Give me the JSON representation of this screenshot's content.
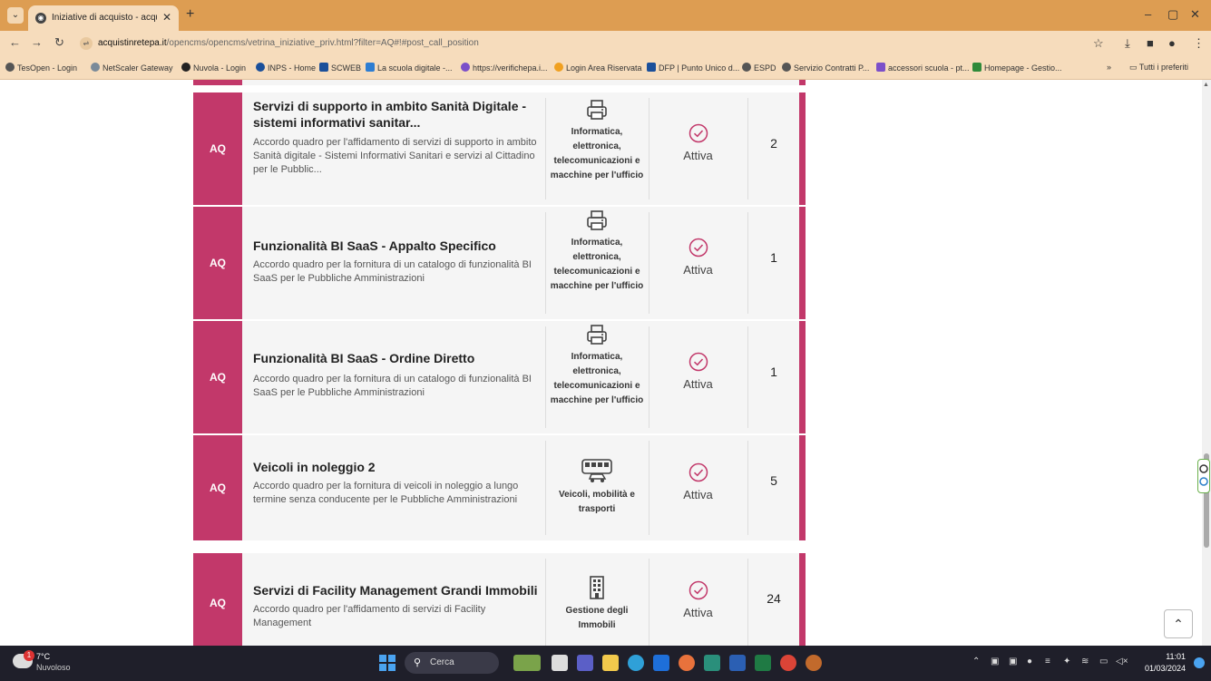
{
  "browser": {
    "tab_title": "Iniziative di acquisto - acquistinretepa",
    "url_domain": "acquistinretepa.it",
    "url_path": "/opencms/opencms/vetrina_iniziative_priv.html?filter=AQ#!#post_call_position",
    "bookmarks": [
      "TesOpen - Login",
      "NetScaler Gateway",
      "Nuvola - Login",
      "INPS - Home",
      "SCWEB",
      "La scuola digitale -...",
      "https://verifichepa.i...",
      "Login Area Riservata",
      "DFP | Punto Unico d...",
      "ESPD",
      "Servizio Contratti P...",
      "accessori scuola - pt...",
      "Homepage - Gestio..."
    ],
    "all_bookmarks_label": "Tutti i preferiti"
  },
  "colors": {
    "accent": "#c2386a",
    "tabbar": "#dd9d52",
    "toolbar": "#f6dcbc",
    "row_bg": "#f5f5f5"
  },
  "rows": [
    {
      "badge": "AQ",
      "title": "Servizi di supporto in ambito Sanità Digitale - sistemi informativi sanitar...",
      "description": "Accordo quadro per l'affidamento di servizi di supporto in ambito Sanità digitale - Sistemi Informativi Sanitari e servizi al Cittadino per le Pubblic...",
      "category": "Informatica, elettronica, telecomunicazioni e macchine per l'ufficio",
      "category_icon": "printer-icon",
      "status": "Attiva",
      "count": "2"
    },
    {
      "badge": "AQ",
      "title": "Funzionalità BI SaaS - Appalto Specifico",
      "description": "Accordo quadro per la fornitura di un catalogo di funzionalità BI SaaS per le Pubbliche Amministrazioni",
      "category": "Informatica, elettronica, telecomunicazioni e macchine per l'ufficio",
      "category_icon": "printer-icon",
      "status": "Attiva",
      "count": "1"
    },
    {
      "badge": "AQ",
      "title": "Funzionalità BI SaaS - Ordine Diretto",
      "description": "Accordo quadro per la fornitura di un catalogo di funzionalità BI SaaS per le Pubbliche Amministrazioni",
      "category": "Informatica, elettronica, telecomunicazioni e macchine per l'ufficio",
      "category_icon": "printer-icon",
      "status": "Attiva",
      "count": "1"
    },
    {
      "badge": "AQ",
      "title": "Veicoli in noleggio 2",
      "description": "Accordo quadro per la fornitura di veicoli in noleggio a lungo termine senza conducente per le Pubbliche Amministrazioni",
      "category": "Veicoli, mobilità e trasporti",
      "category_icon": "vehicles-icon",
      "status": "Attiva",
      "count": "5"
    },
    {
      "badge": "AQ",
      "title": "Servizi di Facility Management Grandi Immobili",
      "description": "Accordo quadro per l'affidamento di servizi di Facility Management",
      "category": "Gestione degli Immobili",
      "category_icon": "building-icon",
      "status": "Attiva",
      "count": "24"
    }
  ],
  "taskbar": {
    "weather_temp": "7°C",
    "weather_desc": "Nuvoloso",
    "weather_badge": "1",
    "search_label": "Cerca",
    "time": "11:01",
    "date": "01/03/2024"
  }
}
